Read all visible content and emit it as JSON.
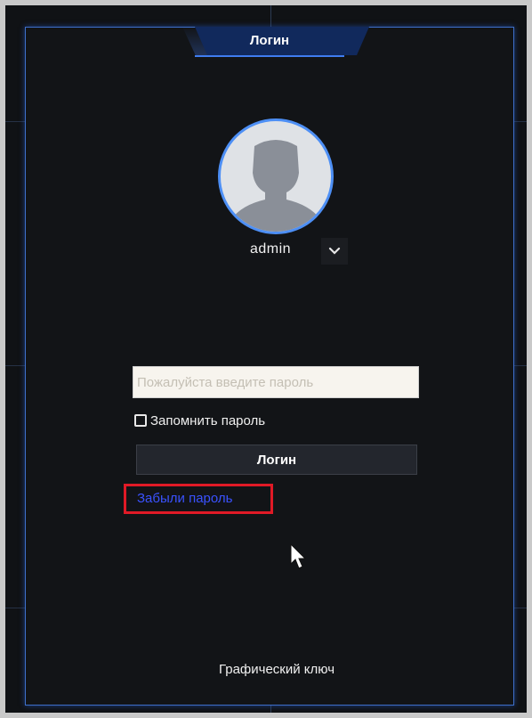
{
  "dialog": {
    "title": "Логин"
  },
  "user": {
    "name": "admin"
  },
  "password": {
    "placeholder": "Пожалуйста введите пароль",
    "value": ""
  },
  "remember": {
    "label": "Запомнить пароль",
    "checked": false
  },
  "login_button": {
    "label": "Логин"
  },
  "forgot": {
    "label": "Забыли пароль"
  },
  "pattern": {
    "label": "Графический ключ"
  },
  "icons": {
    "avatar": "user-silhouette-icon",
    "dropdown": "chevron-down-icon",
    "cursor": "mouse-pointer-icon"
  },
  "colors": {
    "accent": "#3e6fc9",
    "link": "#3a52ff",
    "highlight": "#e01a26"
  }
}
